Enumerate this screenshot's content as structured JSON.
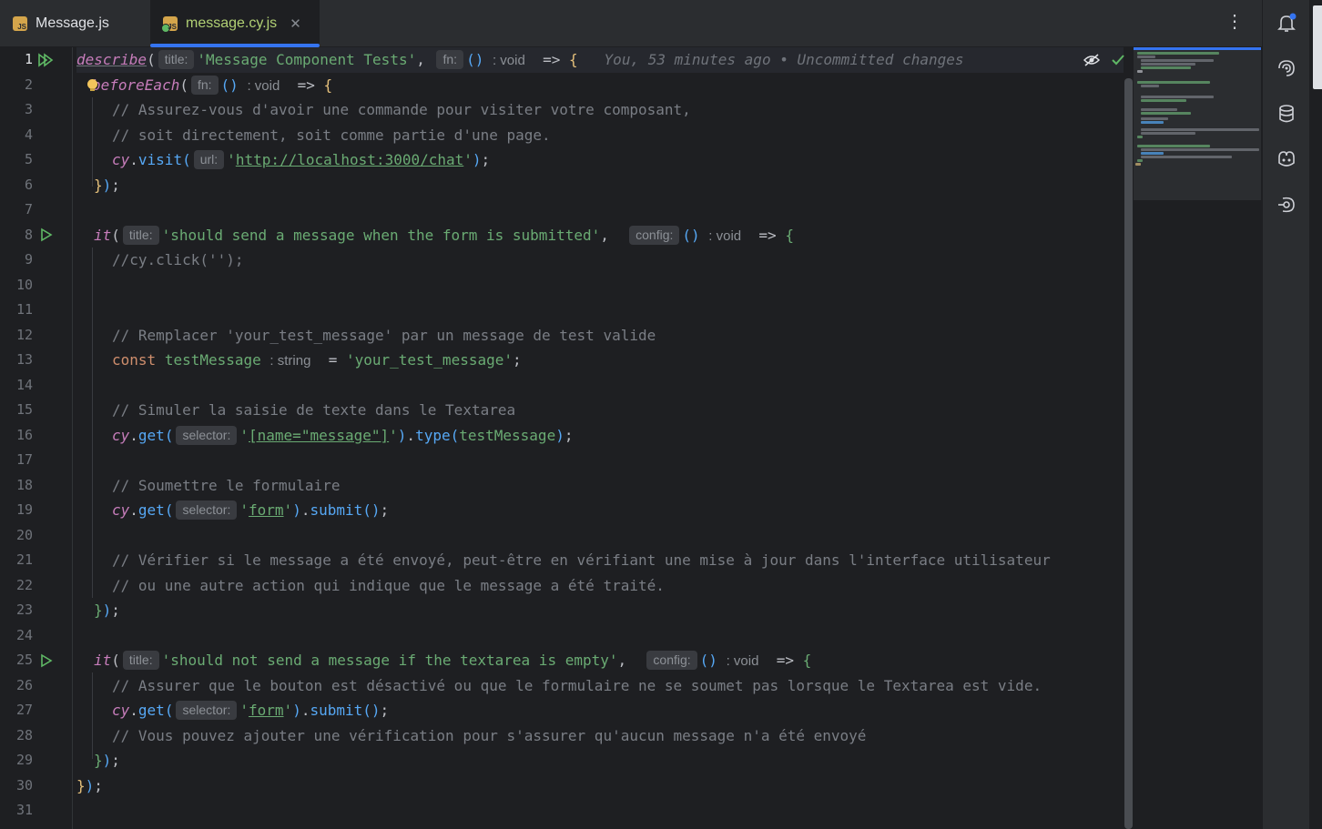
{
  "tabs": [
    {
      "label": "Message.js",
      "active": false
    },
    {
      "label": "message.cy.js",
      "active": true
    }
  ],
  "blame": "You, 53 minutes ago • Uncommitted changes",
  "hints": {
    "title": "title:",
    "fn": "fn:",
    "url": "url:",
    "config": "config:",
    "selector": "selector:",
    "void": ": void",
    "string": ": string"
  },
  "code": {
    "l1_describe": "describe",
    "l1_title": "'Message Component Tests'",
    "l2_before": "beforeEach",
    "l3": "// Assurez-vous d'avoir une commande pour visiter votre composant,",
    "l4": "// soit directement, soit comme partie d'une page.",
    "l5_cy": "cy",
    "l5_visit": "visit",
    "l5_url": "http://localhost:3000/chat",
    "l8_it": "it",
    "l8_title": "'should send a message when the form is submitted'",
    "l9": "//cy.click('');",
    "l12": "// Remplacer 'your_test_message' par un message de test valide",
    "l13_const": "const",
    "l13_name": "testMessage",
    "l13_val": "'your_test_message'",
    "l15": "// Simuler la saisie de texte dans le Textarea",
    "l16_get": "get",
    "l16_sel": "[name=\"message\"]",
    "l16_type": "type",
    "l16_arg": "testMessage",
    "l18": "// Soumettre le formulaire",
    "l19_sel": "form",
    "l19_submit": "submit",
    "l21": "// Vérifier si le message a été envoyé, peut-être en vérifiant une mise à jour dans l'interface utilisateur",
    "l22": "// ou une autre action qui indique que le message a été traité.",
    "l25_title": "'should not send a message if the textarea is empty'",
    "l26": "// Assurer que le bouton est désactivé ou que le formulaire ne se soumet pas lorsque le Textarea est vide.",
    "l28": "// Vous pouvez ajouter une vérification pour s'assurer qu'aucun message n'a été envoyé"
  },
  "line_numbers": [
    "1",
    "2",
    "3",
    "4",
    "5",
    "6",
    "7",
    "8",
    "9",
    "10",
    "11",
    "12",
    "13",
    "14",
    "15",
    "16",
    "17",
    "18",
    "19",
    "20",
    "21",
    "22",
    "23",
    "24",
    "25",
    "26",
    "27",
    "28",
    "29",
    "30",
    "31"
  ],
  "icons": {
    "tab_file": "javascript-file-icon",
    "tab_test": "javascript-test-file-icon",
    "run": "run-test-icon",
    "notifications": "notifications-bell-icon",
    "ai": "ai-assistant-icon",
    "database": "database-icon",
    "copilot": "copilot-icon",
    "endpoints": "endpoints-icon"
  },
  "colors": {
    "accent": "#3574f0",
    "run_green": "#5fb865",
    "string": "#6aab73",
    "keyword": "#cf8e6d",
    "function": "#56a8f5",
    "comment": "#7a7e85"
  }
}
